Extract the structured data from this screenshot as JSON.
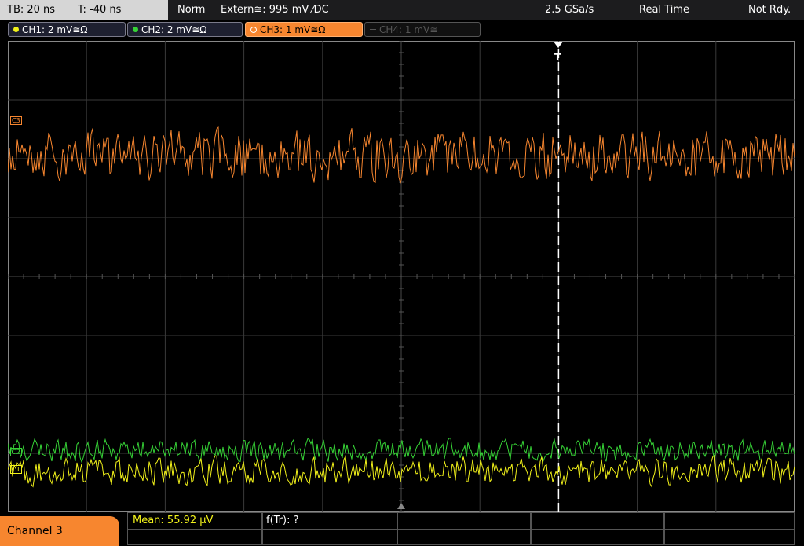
{
  "timebase": {
    "tb_label": "TB: 20 ns",
    "t_label": "T: -40 ns"
  },
  "trigger": {
    "mode": "Norm",
    "source": "Extern≅: 995 mV ⁄DC"
  },
  "acq": {
    "sample_rate": "2.5 GSa/s",
    "mode": "Real Time",
    "state": "Not Rdy."
  },
  "channels": [
    {
      "label": "CH1: 2 mV≅Ω",
      "color": "#f2f21a"
    },
    {
      "label": "CH2: 2 mV≅Ω",
      "color": "#36d236"
    },
    {
      "label": "CH3: 1 mV≅Ω",
      "color": "#f7862f"
    },
    {
      "label": "CH4: 1 mV≅",
      "color": "#5a5a5a"
    }
  ],
  "markers": {
    "c3": "C3",
    "c1": "C1",
    "c2": "C2",
    "trigger": "T"
  },
  "bottom": {
    "channel_tab": "Channel 3",
    "mean": "Mean: 55.92 µV",
    "ftr": "f(Tr): ?"
  },
  "chart_data": {
    "type": "line",
    "title": "",
    "xlabel": "",
    "ylabel": "",
    "x_divisions": 10,
    "y_divisions": 8,
    "trigger_position_div": 7,
    "series": [
      {
        "name": "CH3",
        "color": "#f7862f",
        "center_div": 1.95,
        "noise_div": 0.45
      },
      {
        "name": "CH2",
        "color": "#36d236",
        "center_div": 6.95,
        "noise_div": 0.2
      },
      {
        "name": "CH1",
        "color": "#f2f21a",
        "center_div": 7.3,
        "noise_div": 0.25
      }
    ]
  }
}
